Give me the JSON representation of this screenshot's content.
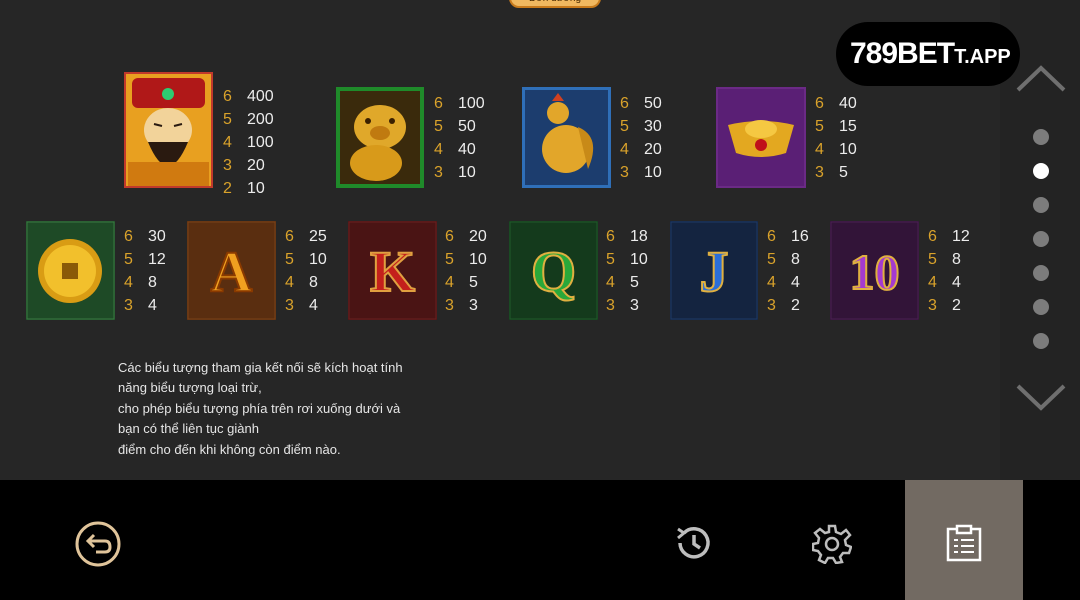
{
  "top_tab_label": "Đơn dương",
  "logo": {
    "main": "789BET",
    "suffix": "T.APP"
  },
  "row1": [
    {
      "icon": "god-of-wealth-symbol",
      "pays": [
        [
          "6",
          "400"
        ],
        [
          "5",
          "200"
        ],
        [
          "4",
          "100"
        ],
        [
          "3",
          "20"
        ],
        [
          "2",
          "10"
        ]
      ]
    },
    {
      "icon": "golden-pig-symbol",
      "pays": [
        [
          "6",
          "100"
        ],
        [
          "5",
          "50"
        ],
        [
          "4",
          "40"
        ],
        [
          "3",
          "10"
        ]
      ]
    },
    {
      "icon": "golden-rooster-symbol",
      "pays": [
        [
          "6",
          "50"
        ],
        [
          "5",
          "30"
        ],
        [
          "4",
          "20"
        ],
        [
          "3",
          "10"
        ]
      ]
    },
    {
      "icon": "gold-ingot-symbol",
      "pays": [
        [
          "6",
          "40"
        ],
        [
          "5",
          "15"
        ],
        [
          "4",
          "10"
        ],
        [
          "3",
          "5"
        ]
      ]
    }
  ],
  "row2": [
    {
      "icon": "gold-coin-symbol",
      "label": "",
      "pays": [
        [
          "6",
          "30"
        ],
        [
          "5",
          "12"
        ],
        [
          "4",
          "8"
        ],
        [
          "3",
          "4"
        ]
      ]
    },
    {
      "icon": "letter-a-symbol",
      "label": "A",
      "pays": [
        [
          "6",
          "25"
        ],
        [
          "5",
          "10"
        ],
        [
          "4",
          "8"
        ],
        [
          "3",
          "4"
        ]
      ]
    },
    {
      "icon": "letter-k-symbol",
      "label": "K",
      "pays": [
        [
          "6",
          "20"
        ],
        [
          "5",
          "10"
        ],
        [
          "4",
          "5"
        ],
        [
          "3",
          "3"
        ]
      ]
    },
    {
      "icon": "letter-q-symbol",
      "label": "Q",
      "pays": [
        [
          "6",
          "18"
        ],
        [
          "5",
          "10"
        ],
        [
          "4",
          "5"
        ],
        [
          "3",
          "3"
        ]
      ]
    },
    {
      "icon": "letter-j-symbol",
      "label": "J",
      "pays": [
        [
          "6",
          "16"
        ],
        [
          "5",
          "8"
        ],
        [
          "4",
          "4"
        ],
        [
          "3",
          "2"
        ]
      ]
    },
    {
      "icon": "number-10-symbol",
      "label": "10",
      "pays": [
        [
          "6",
          "12"
        ],
        [
          "5",
          "8"
        ],
        [
          "4",
          "4"
        ],
        [
          "3",
          "2"
        ]
      ]
    }
  ],
  "description": [
    "Các biểu tượng tham gia kết nối sẽ kích hoạt tính",
    "năng biểu tượng loại trừ,",
    "cho phép biểu tượng phía trên rơi xuống dưới và",
    "bạn có thể liên tục giành",
    "điểm cho đến khi không còn điểm nào."
  ],
  "pagination": {
    "pages": 7,
    "active_index": 1
  },
  "colors": {
    "count": "#d9a22b",
    "amount": "#ececec",
    "panel": "#262626",
    "active_tab": "#726a62"
  },
  "bottom_icons": [
    "back-icon",
    "history-icon",
    "settings-icon",
    "paytable-icon"
  ]
}
